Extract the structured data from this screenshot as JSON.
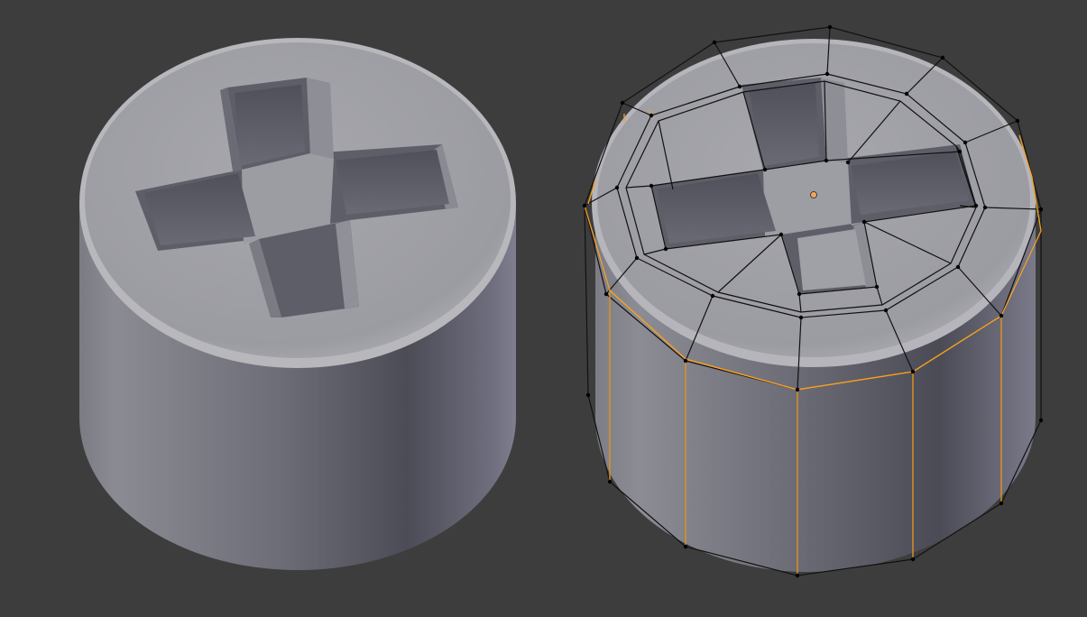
{
  "viewport": {
    "background": "#3d3d3d",
    "mode": "edit-mode",
    "objects": [
      {
        "id": "smooth-cap",
        "shading": "smooth",
        "subdivision": "applied"
      },
      {
        "id": "cage-cap",
        "shading": "smooth",
        "subdivision": "modifier-on-cage",
        "show_wireframe": true,
        "selected_edge_loop": "bevel-lower-ring",
        "origin_visible": true
      }
    ]
  },
  "colors": {
    "body_light": "#8d8d96",
    "body_mid": "#6c6c76",
    "body_dark": "#4a4a55",
    "rim": "#b5b5bb",
    "top": "#a3a3a9",
    "recess": "#5f5f6a",
    "wire": "#111111",
    "selection": "#f5a021",
    "origin": "#f5a35a"
  }
}
